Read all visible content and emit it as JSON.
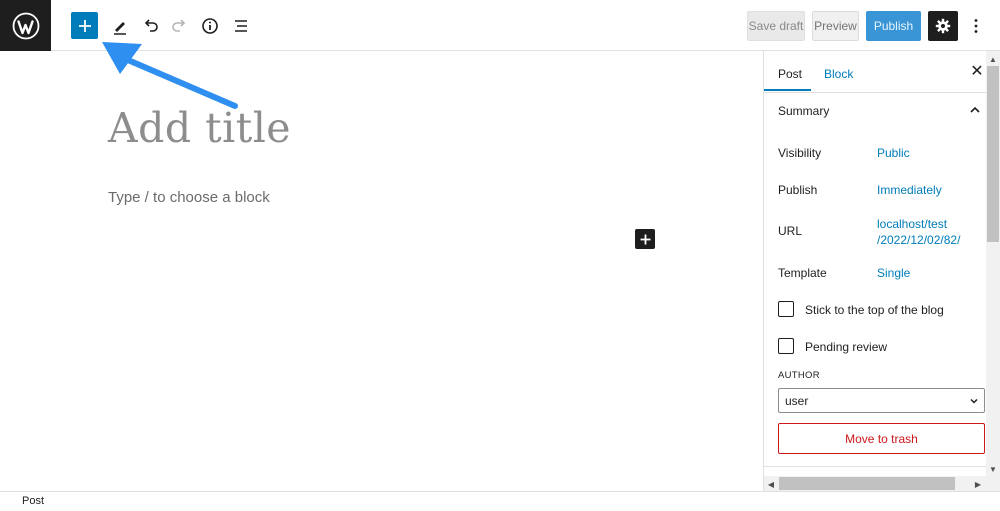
{
  "toolbar": {
    "save_draft_label": "Save draft",
    "preview_label": "Preview",
    "publish_label": "Publish",
    "icons": [
      "wordpress-logo",
      "plus-icon",
      "pencil-icon",
      "undo-icon",
      "redo-icon",
      "info-icon",
      "list-view-icon",
      "gear-icon",
      "more-vertical-icon"
    ]
  },
  "editor": {
    "title_placeholder": "Add title",
    "block_placeholder": "Type / to choose a block"
  },
  "sidebar": {
    "tabs": [
      {
        "label": "Post",
        "active": true
      },
      {
        "label": "Block",
        "active": false
      }
    ],
    "summary": {
      "title": "Summary",
      "rows": [
        {
          "label": "Visibility",
          "value": "Public"
        },
        {
          "label": "Publish",
          "value": "Immediately"
        },
        {
          "label": "URL",
          "value_line1": "localhost/test",
          "value_line2": "/2022/12/02/82/"
        },
        {
          "label": "Template",
          "value": "Single"
        }
      ],
      "checkboxes": [
        {
          "label": "Stick to the top of the blog",
          "checked": false
        },
        {
          "label": "Pending review",
          "checked": false
        }
      ],
      "author_heading": "AUTHOR",
      "author_value": "user",
      "trash_label": "Move to trash"
    }
  },
  "footer": {
    "breadcrumb": "Post"
  },
  "colors": {
    "accent": "#007cba",
    "danger": "#cc1818",
    "dark": "#1e1e1e",
    "annotation_arrow": "#2e8ff0"
  }
}
